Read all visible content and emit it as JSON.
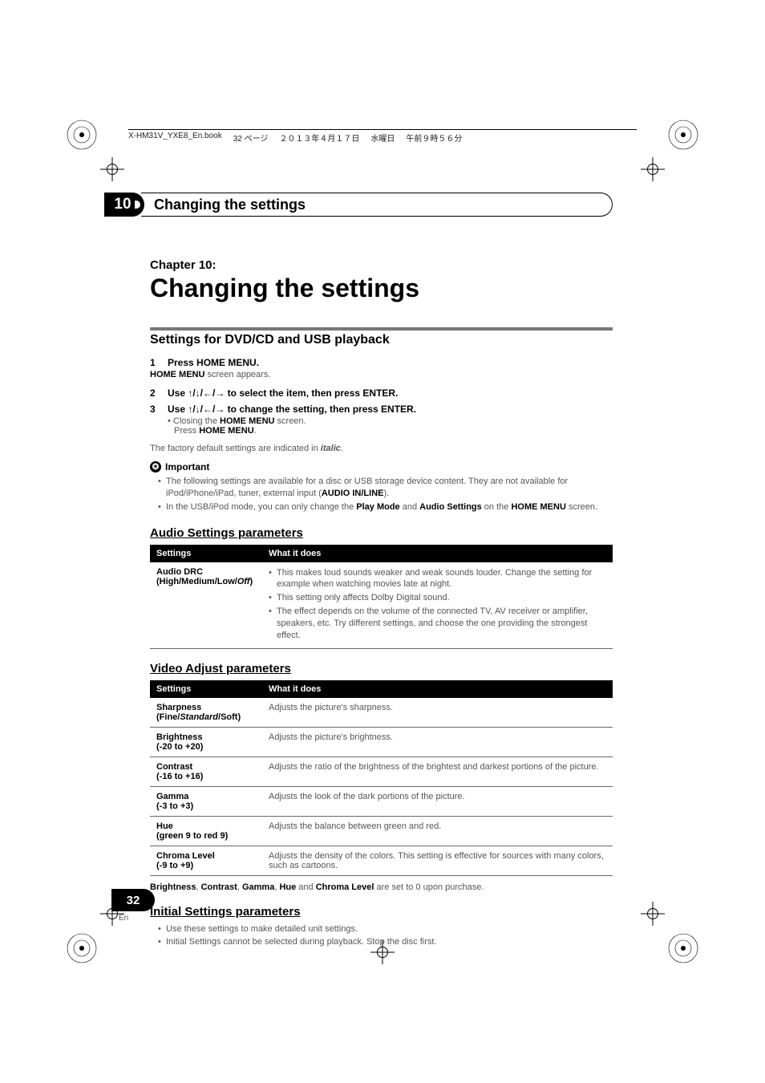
{
  "header_line": {
    "filename": "X-HM31V_YXE8_En.book",
    "pageinfo": "32 ページ",
    "date": "２０１３年４月１７日",
    "weekday": "水曜日",
    "time": "午前９時５６分"
  },
  "chapter_number": "10",
  "chapter_bar_title": "Changing the settings",
  "chapter_label": "Chapter 10:",
  "main_title": "Changing the settings",
  "section_title": "Settings for DVD/CD and USB playback",
  "steps": [
    {
      "num": "1",
      "text": "Press HOME MENU."
    },
    {
      "num": "2",
      "text": "Use ↑/↓/←/→ to select the item, then press ENTER."
    },
    {
      "num": "3",
      "text": "Use ↑/↓/←/→ to change the setting, then press ENTER."
    }
  ],
  "step1_sub_pre": "",
  "step1_sub_bold": "HOME MENU",
  "step1_sub_post": " screen appears.",
  "step3_sub1_pre": "Closing the ",
  "step3_sub1_bold": "HOME MENU",
  "step3_sub1_post": " screen.",
  "step3_sub2_pre": "Press ",
  "step3_sub2_bold": "HOME MENU",
  "step3_sub2_post": ".",
  "factory_note_pre": "The factory default settings are indicated in ",
  "factory_note_ital": "italic",
  "factory_note_post": ".",
  "important_label": "Important",
  "important_bullets": [
    {
      "pre": "The following settings are available for a disc or USB storage device content. They are not available for iPod/iPhone/iPad, tuner, external input (",
      "bold": "AUDIO IN/LINE",
      "post": ")."
    },
    {
      "pre": "In the USB/iPod mode, you can only change the ",
      "bold": "Play Mode",
      "mid": " and ",
      "bold2": "Audio Settings",
      "mid2": " on the ",
      "bold3": "HOME MENU",
      "post": " screen."
    }
  ],
  "audio_settings": {
    "title": "Audio Settings parameters",
    "headers": [
      "Settings",
      "What it does"
    ],
    "row": {
      "name": "Audio DRC",
      "options_pre": "(High/Medium/Low/",
      "options_ital": "Off",
      "options_post": ")",
      "bullets": [
        "This makes loud sounds weaker and weak sounds louder. Change the setting for example when watching movies late at night.",
        "This setting only affects Dolby Digital sound.",
        "The effect depends on the volume of the connected TV, AV receiver or amplifier, speakers, etc. Try different settings, and choose the one providing the strongest effect."
      ]
    }
  },
  "video_adjust": {
    "title": "Video Adjust parameters",
    "headers": [
      "Settings",
      "What it does"
    ],
    "rows": [
      {
        "name": "Sharpness",
        "opts_pre": "(Fine/",
        "opts_ital": "Standard",
        "opts_post": "/Soft)",
        "desc": "Adjusts the picture's sharpness."
      },
      {
        "name": "Brightness",
        "opts": "(-20 to +20)",
        "desc": "Adjusts the picture's brightness."
      },
      {
        "name": "Contrast",
        "opts": "(-16 to +16)",
        "desc": "Adjusts the ratio of the brightness of the brightest and darkest portions of the picture."
      },
      {
        "name": "Gamma",
        "opts": "(-3 to +3)",
        "desc": "Adjusts the look of the dark portions of the picture."
      },
      {
        "name": "Hue",
        "opts": "(green 9 to red 9)",
        "desc": "Adjusts the balance between green and red."
      },
      {
        "name": "Chroma Level",
        "opts": "(-9 to +9)",
        "desc": "Adjusts the density of the colors. This setting is effective for sources with many colors, such as cartoons."
      }
    ]
  },
  "post_table_b1": "Brightness",
  "post_table_b2": "Contrast",
  "post_table_b3": "Gamma",
  "post_table_b4": "Hue",
  "post_table_b5": "Chroma Level",
  "post_table_tail": " are set to 0 upon purchase.",
  "initial_settings": {
    "title": "Initial Settings parameters",
    "bullets": [
      "Use these settings to make detailed unit settings.",
      "Initial Settings cannot be selected during playback. Stop the disc first."
    ]
  },
  "page_number": "32",
  "page_lang": "En"
}
